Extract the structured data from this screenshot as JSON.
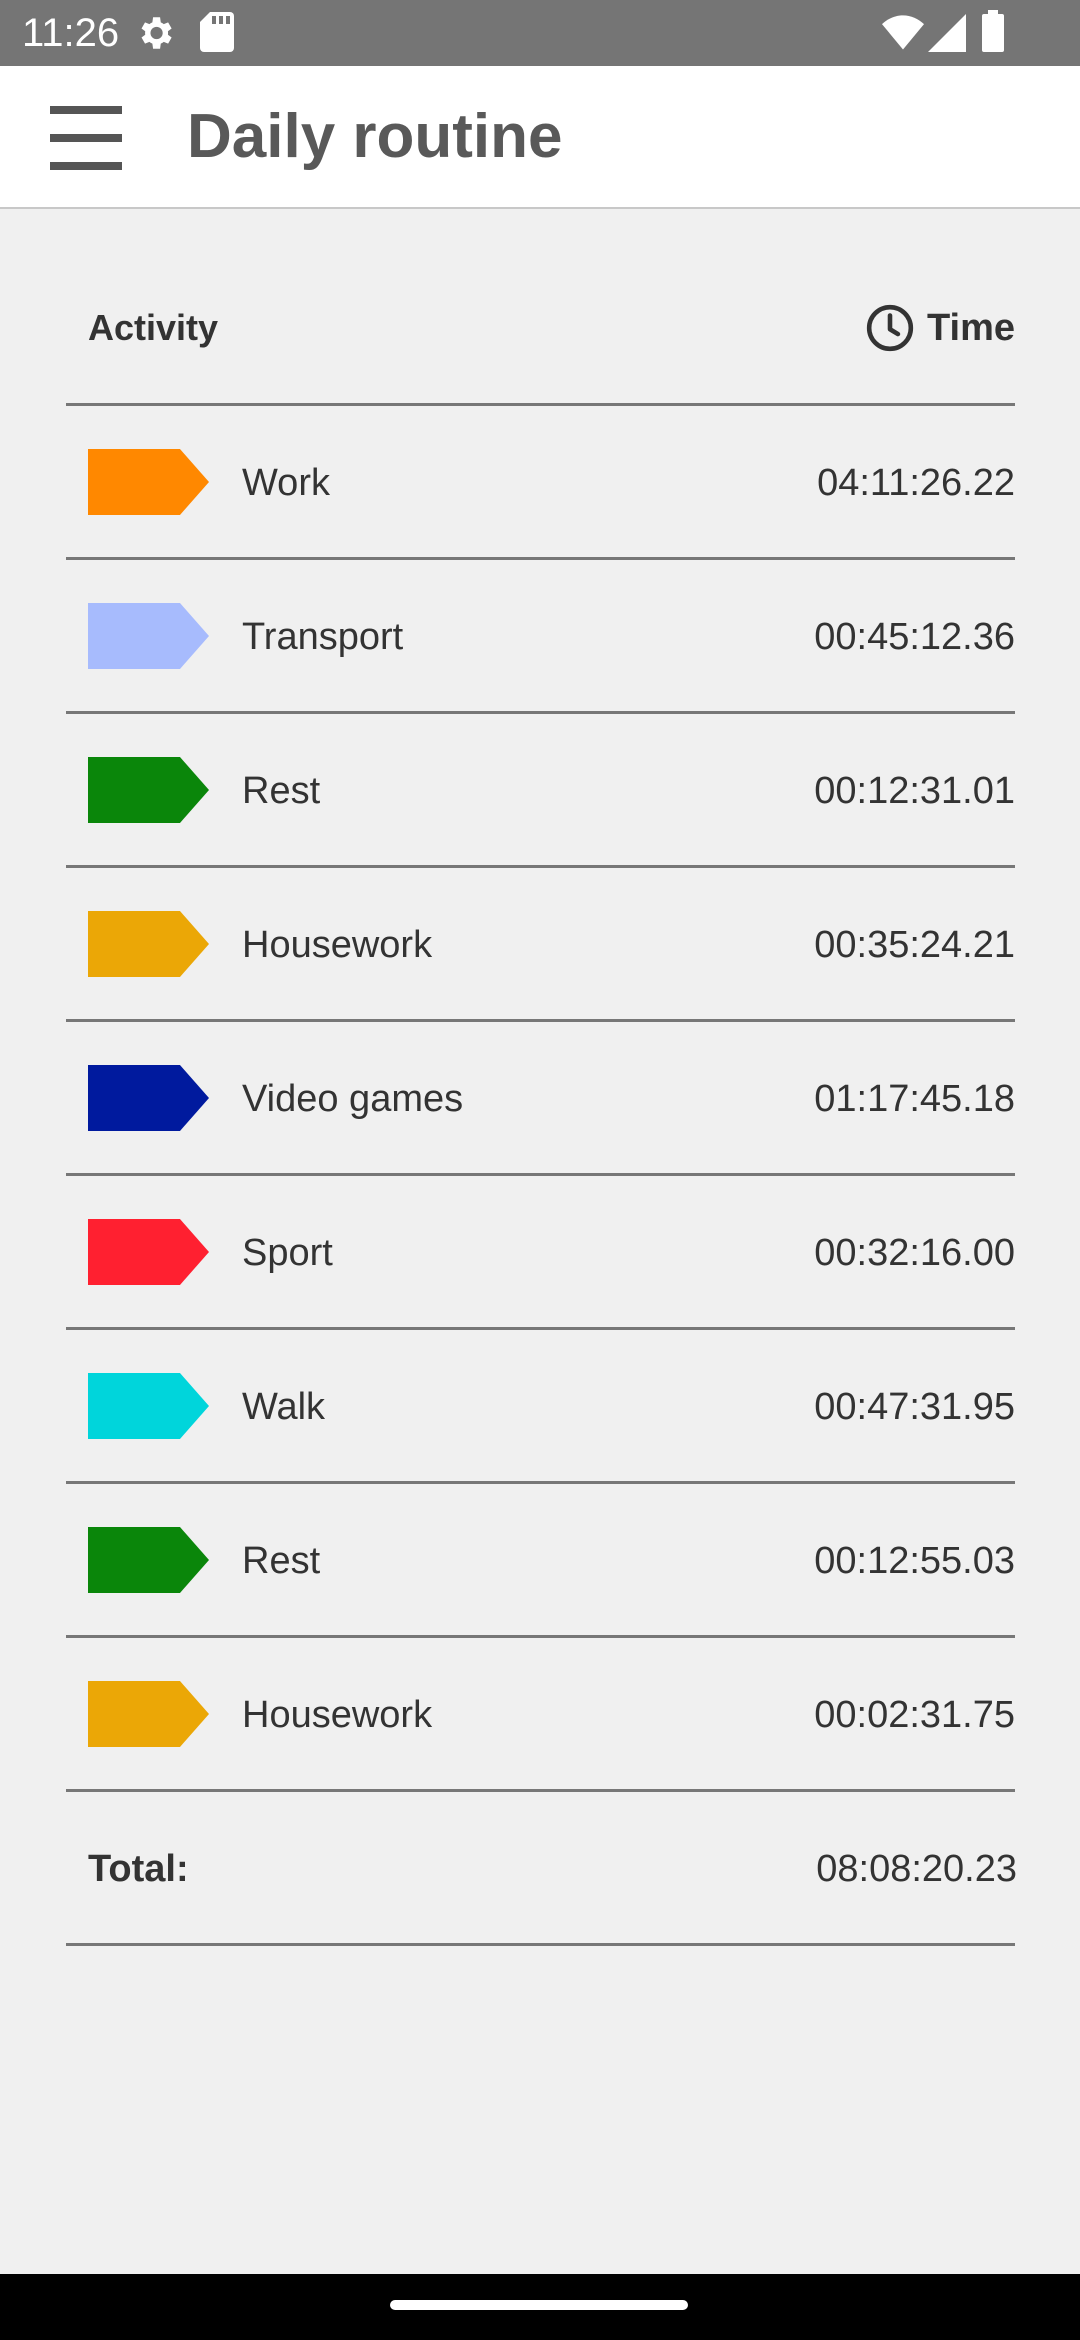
{
  "status_bar": {
    "time": "11:26",
    "icons": [
      "settings-gear-icon",
      "sd-card-icon",
      "wifi-icon",
      "signal-icon",
      "battery-icon"
    ]
  },
  "app_bar": {
    "menu_icon": "hamburger-menu-icon",
    "title": "Daily routine"
  },
  "table": {
    "header": {
      "activity_label": "Activity",
      "time_icon": "clock-icon",
      "time_label": "Time"
    },
    "rows": [
      {
        "name": "Work",
        "time": "04:11:26.22",
        "color": "#FF8800"
      },
      {
        "name": "Transport",
        "time": "00:45:12.36",
        "color": "#A7BBFD"
      },
      {
        "name": "Rest",
        "time": "00:12:31.01",
        "color": "#0A860A"
      },
      {
        "name": "Housework",
        "time": "00:35:24.21",
        "color": "#EBA706"
      },
      {
        "name": "Video games",
        "time": "01:17:45.18",
        "color": "#001A9E"
      },
      {
        "name": "Sport",
        "time": "00:32:16.00",
        "color": "#FF2030"
      },
      {
        "name": "Walk",
        "time": "00:47:31.95",
        "color": "#00D5DB"
      },
      {
        "name": "Rest",
        "time": "00:12:55.03",
        "color": "#0A860A"
      },
      {
        "name": "Housework",
        "time": "00:02:31.75",
        "color": "#EBA706"
      }
    ],
    "total": {
      "label": "Total:",
      "value": "08:08:20.23"
    }
  },
  "colors": {
    "status_bar": "#757575",
    "background": "#F0F0F0",
    "app_bar": "#FFFFFF",
    "title": "#595959",
    "divider": "#777777"
  }
}
